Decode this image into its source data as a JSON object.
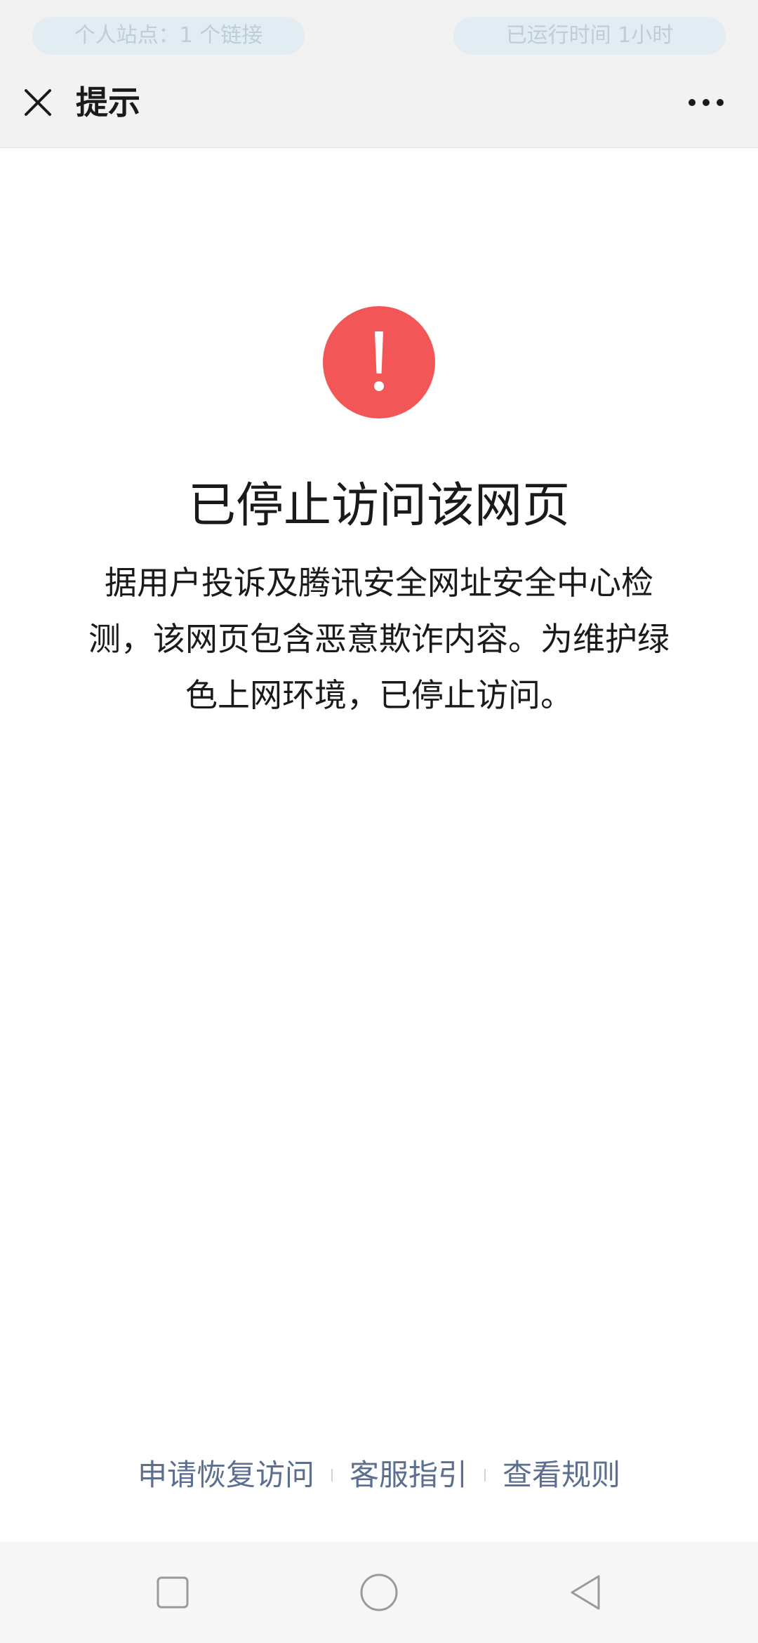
{
  "top_overlay": {
    "left_pill": "个人站点：1 个链接",
    "right_pill": "已运行时间 1小时"
  },
  "header": {
    "title": "提示",
    "close_icon": "close-icon",
    "more_icon": "more-horizontal-icon"
  },
  "main": {
    "warning_icon": "exclamation-icon",
    "warning_color": "#f25656",
    "title": "已停止访问该网页",
    "description": "据用户投诉及腾讯安全网址安全中心检测，该网页包含恶意欺诈内容。为维护绿色上网环境，已停止访问。"
  },
  "footer": {
    "links": [
      "申请恢复访问",
      "客服指引",
      "查看规则"
    ],
    "link_color": "#5c6f8f"
  },
  "nav_bar": {
    "recent_icon": "square-icon",
    "home_icon": "circle-icon",
    "back_icon": "triangle-back-icon"
  }
}
